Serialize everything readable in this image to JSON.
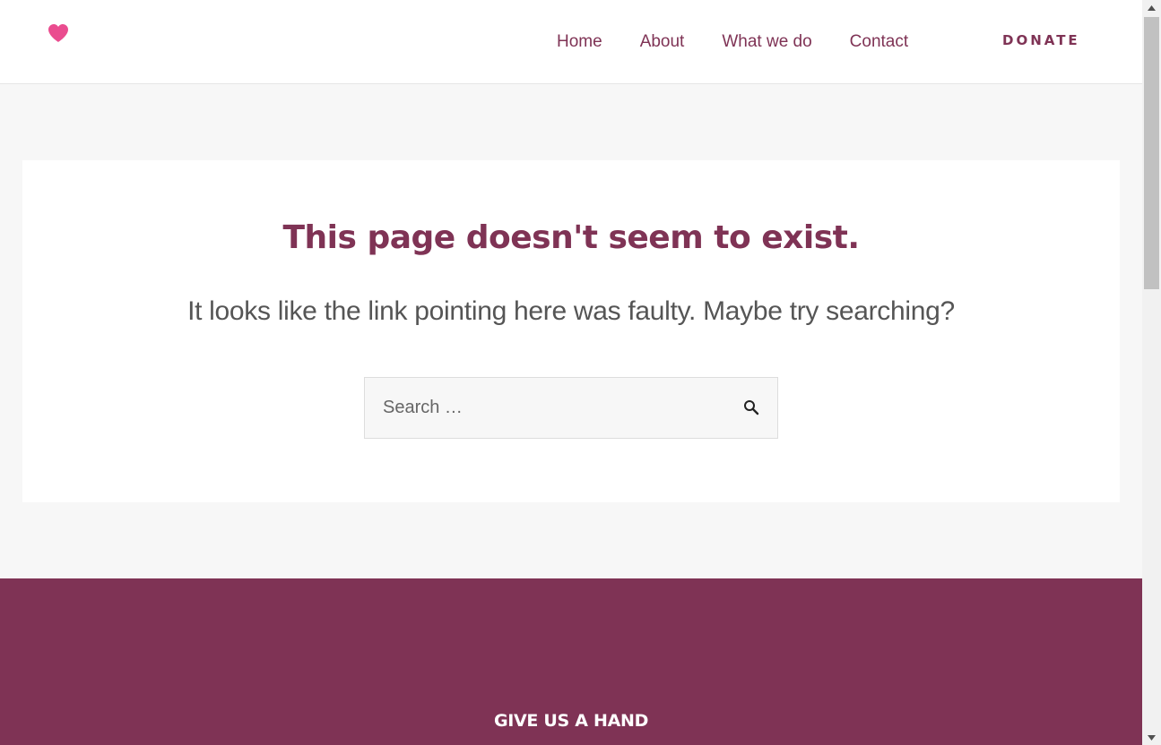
{
  "header": {
    "logo_icon": "heart-icon",
    "logo_color": "#e94a8c",
    "nav": [
      {
        "label": "Home"
      },
      {
        "label": "About"
      },
      {
        "label": "What we do"
      },
      {
        "label": "Contact"
      }
    ],
    "donate_label": "DONATE"
  },
  "main": {
    "title": "This page doesn't seem to exist.",
    "subtitle": "It looks like the link pointing here was faulty. Maybe try searching?",
    "search": {
      "placeholder": "Search …",
      "value": "",
      "button_icon": "search-icon"
    }
  },
  "footer": {
    "heading": "GIVE US A HAND"
  },
  "colors": {
    "brand": "#7f3355",
    "text_muted": "#555555",
    "page_bg": "#f7f7f7"
  }
}
